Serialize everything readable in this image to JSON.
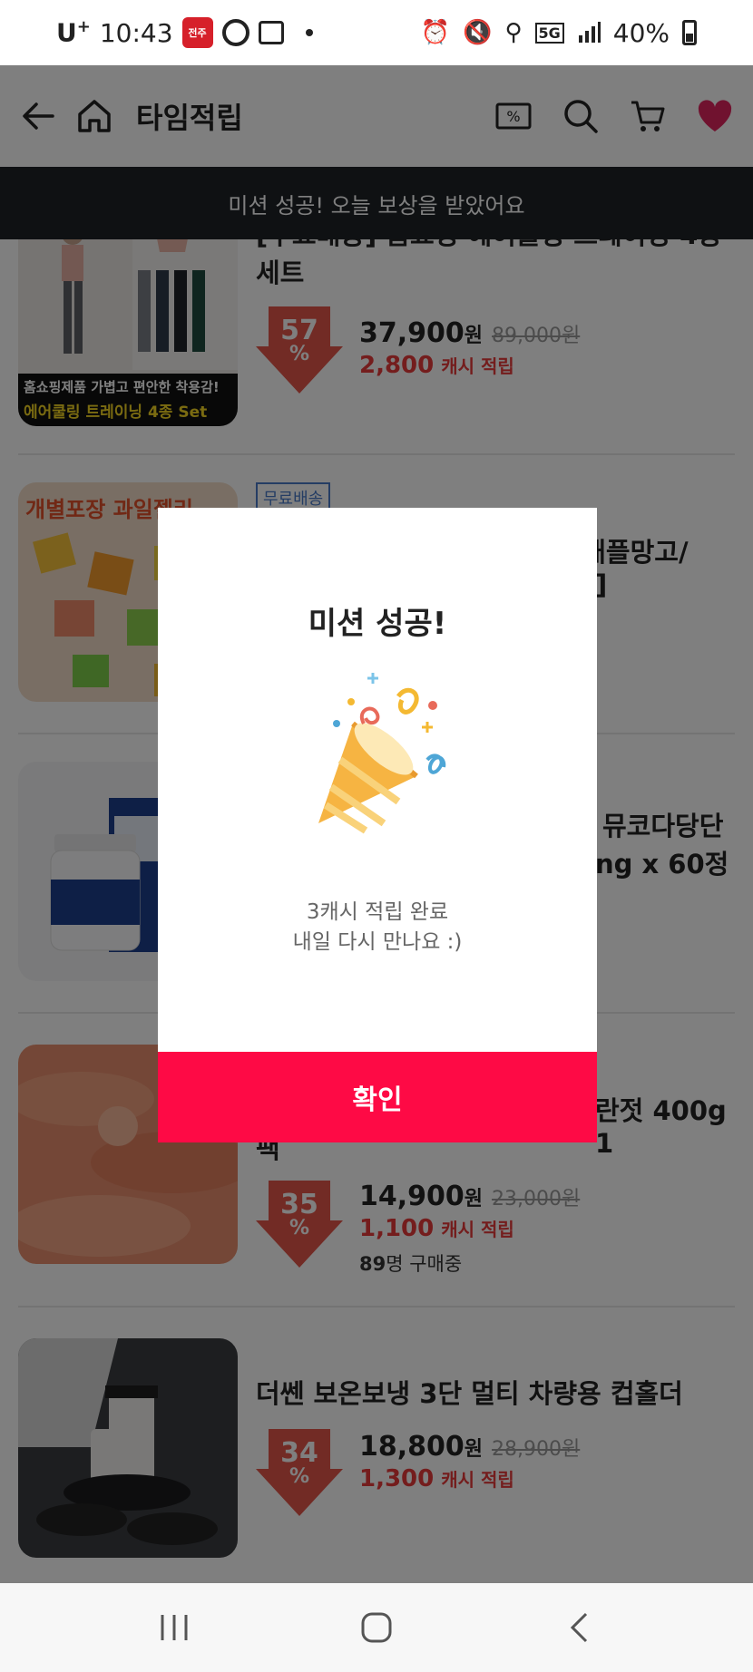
{
  "status_bar": {
    "carrier": "U",
    "carrier_plus": "+",
    "time": "10:43",
    "app_badge": "전주",
    "network": "5G",
    "battery": "40%"
  },
  "header": {
    "title": "타임적립"
  },
  "toast": {
    "text": "미션 성공! 오늘 보상을 받았어요"
  },
  "products": [
    {
      "title": "[무료배송] 홈쇼핑 에어쿨링 트레이닝 4종 세트",
      "thumb_caption_1": "홈쇼핑제품 가볍고 편안한 착용감!",
      "thumb_caption_2": "에어쿨링 트레이닝 4종 Set",
      "discount": "57",
      "discount_unit": "%",
      "price": "37,900",
      "price_unit": "원",
      "original_price": "89,000",
      "original_unit": "원",
      "cash": "2,800",
      "cash_label": "캐시 적립"
    },
    {
      "tag": "무료배송",
      "title_tail_1": "(애플망고/",
      "title_tail_2": "]",
      "thumb_caption": "개별포장 과일젤리"
    },
    {
      "title_tail_1": "뮤코다당단",
      "title_tail_2": "ng x 60정"
    },
    {
      "title_tail_1": "란젓 400g 1",
      "title_tail_2": "팩",
      "discount": "35",
      "discount_unit": "%",
      "price": "14,900",
      "price_unit": "원",
      "original_price": "23,000",
      "original_unit": "원",
      "cash": "1,100",
      "cash_label": "캐시 적립",
      "buyers_count": "89",
      "buyers_label": "명 구매중"
    },
    {
      "title": "더쎈 보온보냉 3단 멀티 차량용 컵홀더",
      "discount": "34",
      "discount_unit": "%",
      "price": "18,800",
      "price_unit": "원",
      "original_price": "28,900",
      "original_unit": "원",
      "cash": "1,300",
      "cash_label": "캐시 적립"
    }
  ],
  "modal": {
    "title": "미션 성공!",
    "message_line1": "3캐시 적립 완료",
    "message_line2": "내일 다시 만나요 :)",
    "confirm_label": "확인"
  },
  "colors": {
    "accent": "#fe0a45",
    "discount": "#e5574a",
    "cash": "#e83a3a",
    "toast_bg": "#1e2227"
  }
}
